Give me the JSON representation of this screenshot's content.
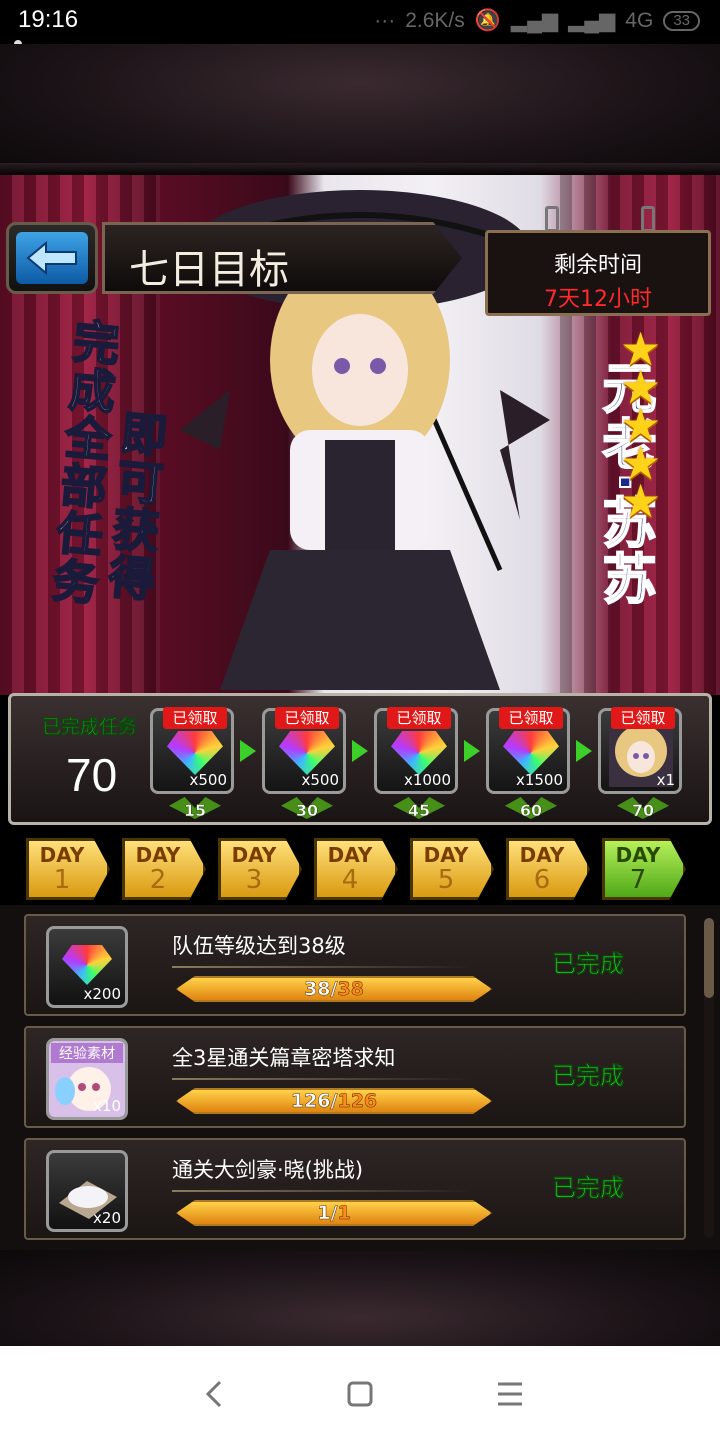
{
  "status": {
    "time": "19:16",
    "net_speed": "2.6K/s",
    "network": "4G",
    "battery": "33"
  },
  "header": {
    "title": "七日目标"
  },
  "timer": {
    "label": "剩余时间",
    "value": "7天12小时"
  },
  "banner": {
    "slogan_line1": "完成全部任务",
    "slogan_line2": "即可获得",
    "hero_name": "元老·苏苏",
    "hero_stars": 5
  },
  "track": {
    "label": "已完成任务",
    "count": "70",
    "rewards": [
      {
        "status": "已领取",
        "qty": "x500",
        "req": "15",
        "icon": "rainbow-gem-icon"
      },
      {
        "status": "已领取",
        "qty": "x500",
        "req": "30",
        "icon": "rainbow-gem-icon"
      },
      {
        "status": "已领取",
        "qty": "x1000",
        "req": "45",
        "icon": "rainbow-gem-icon"
      },
      {
        "status": "已领取",
        "qty": "x1500",
        "req": "60",
        "icon": "rainbow-gem-icon"
      },
      {
        "status": "已领取",
        "qty": "x1",
        "req": "70",
        "icon": "hero-portrait-icon"
      }
    ]
  },
  "days": [
    {
      "label": "DAY",
      "num": "1"
    },
    {
      "label": "DAY",
      "num": "2"
    },
    {
      "label": "DAY",
      "num": "3"
    },
    {
      "label": "DAY",
      "num": "4"
    },
    {
      "label": "DAY",
      "num": "5"
    },
    {
      "label": "DAY",
      "num": "6"
    },
    {
      "label": "DAY",
      "num": "7",
      "active": true
    }
  ],
  "tasks": [
    {
      "name": "队伍等级达到38级",
      "current": "38",
      "total": "38",
      "progress": 1.0,
      "qty": "x200",
      "status": "已完成",
      "icon": "rainbow-gem-icon"
    },
    {
      "name": "全3星通关篇章密塔求知",
      "current": "126",
      "total": "126",
      "progress": 1.0,
      "qty": "x10",
      "status": "已完成",
      "icon": "exp-material-icon",
      "icon_tag": "经验素材"
    },
    {
      "name": "通关大剑豪·晓(挑战)",
      "current": "1",
      "total": "1",
      "progress": 1.0,
      "qty": "x20",
      "status": "已完成",
      "icon": "powder-item-icon"
    }
  ],
  "colors": {
    "done_green": "#3aff3a",
    "claimed_red": "#e01818",
    "timer_red": "#ff2a2a",
    "day_gold": "#f2b93a",
    "day_active": "#7fd23a"
  }
}
